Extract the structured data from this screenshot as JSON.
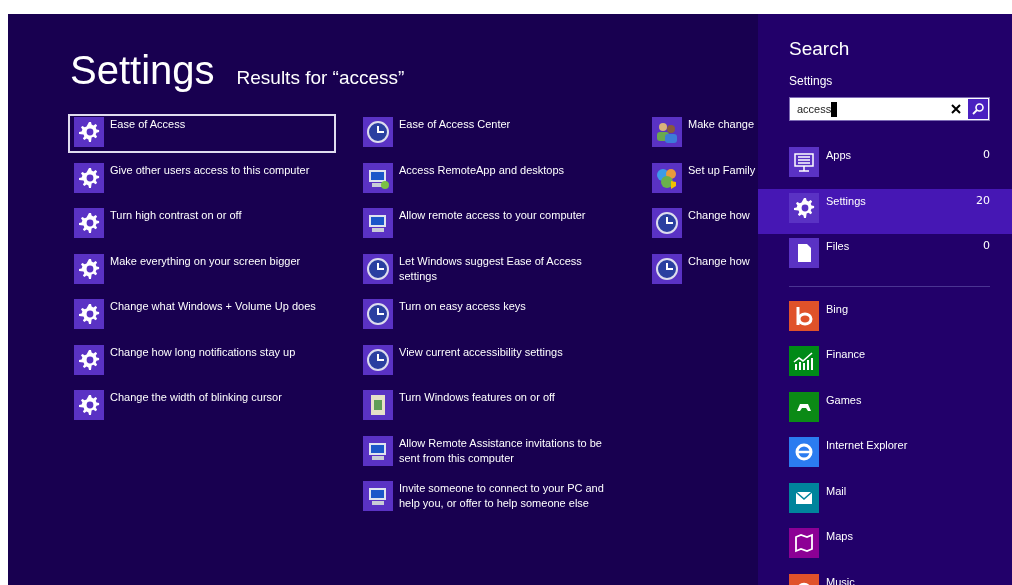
{
  "header": {
    "title": "Settings",
    "subtitle": "Results for “access”"
  },
  "results": [
    [
      {
        "label": "Ease of Access",
        "kind": "gear",
        "selected": true
      },
      {
        "label": "Give other users access to this computer",
        "kind": "gear",
        "selected": false
      },
      {
        "label": "Turn high contrast on or off",
        "kind": "gear",
        "selected": false
      },
      {
        "label": "Make everything on your screen bigger",
        "kind": "gear",
        "selected": false
      },
      {
        "label": "Change what Windows + Volume Up does",
        "kind": "gear",
        "selected": false
      },
      {
        "label": "Change how long notifications stay up",
        "kind": "gear",
        "selected": false
      },
      {
        "label": "Change the width of blinking cursor",
        "kind": "gear",
        "selected": false
      }
    ],
    [
      {
        "label": "Ease of Access Center",
        "kind": "clock",
        "selected": false
      },
      {
        "label": "Access RemoteApp and desktops",
        "kind": "remote",
        "selected": false
      },
      {
        "label": "Allow remote access to your computer",
        "kind": "monitor",
        "selected": false
      },
      {
        "label": "Let Windows suggest Ease of Access settings",
        "kind": "clock",
        "selected": false
      },
      {
        "label": "Turn on easy access keys",
        "kind": "clock",
        "selected": false
      },
      {
        "label": "View current accessibility settings",
        "kind": "clock",
        "selected": false
      },
      {
        "label": "Turn Windows features on or off",
        "kind": "features",
        "selected": false
      },
      {
        "label": "Allow Remote Assistance invitations to be sent from this computer",
        "kind": "monitor",
        "selected": false
      },
      {
        "label": "Invite someone to connect to your PC and help you, or offer to help someone else",
        "kind": "monitor",
        "selected": false
      }
    ],
    [
      {
        "label": "Make change",
        "kind": "users",
        "selected": false
      },
      {
        "label": "Set up Family",
        "kind": "family",
        "selected": false
      },
      {
        "label": "Change how",
        "kind": "clock",
        "selected": false
      },
      {
        "label": "Change how",
        "kind": "clock",
        "selected": false
      }
    ]
  ],
  "search": {
    "title": "Search",
    "scope": "Settings",
    "value": "access",
    "categories": [
      {
        "label": "Apps",
        "count": "0",
        "kind": "keyboard",
        "selected": false
      },
      {
        "label": "Settings",
        "count": "20",
        "kind": "gear",
        "selected": true
      },
      {
        "label": "Files",
        "count": "0",
        "kind": "file",
        "selected": false
      }
    ],
    "apps": [
      {
        "label": "Bing",
        "kind": "bing",
        "color": "#e0522a"
      },
      {
        "label": "Finance",
        "kind": "finance",
        "color": "#008a17"
      },
      {
        "label": "Games",
        "kind": "games",
        "color": "#0b8a16"
      },
      {
        "label": "Internet Explorer",
        "kind": "ie",
        "color": "#2b7cf0"
      },
      {
        "label": "Mail",
        "kind": "mail",
        "color": "#00849c"
      },
      {
        "label": "Maps",
        "kind": "maps",
        "color": "#8c0095"
      },
      {
        "label": "Music",
        "kind": "music",
        "color": "#e0522a"
      }
    ]
  }
}
